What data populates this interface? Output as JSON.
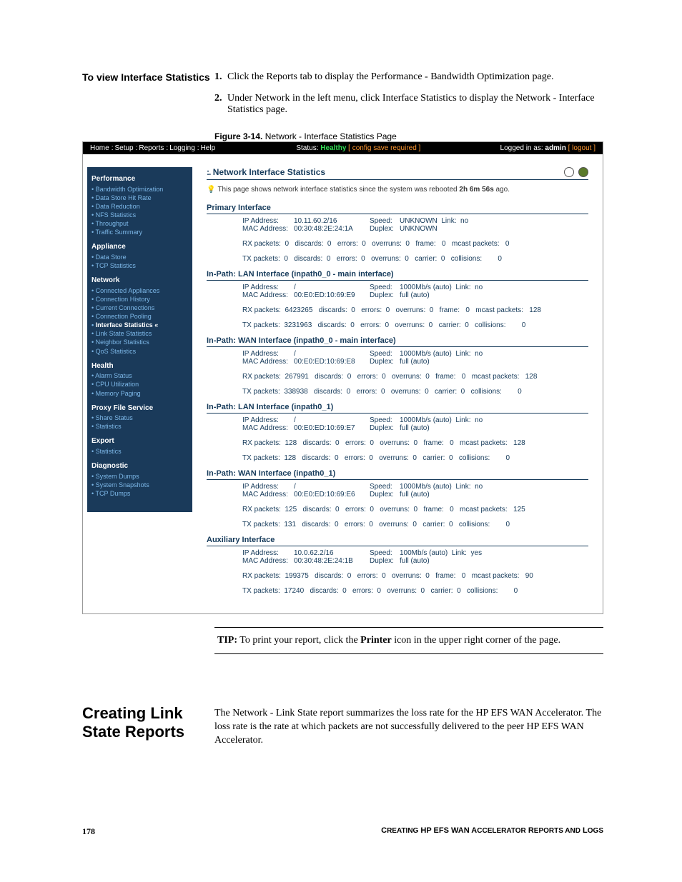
{
  "instructions": {
    "heading": "To view Interface Statistics",
    "steps": [
      "Click the Reports tab to display the Performance - Bandwidth Optimization page.",
      "Under Network in the left menu, click Interface Statistics to display the Network - Interface Statistics page."
    ]
  },
  "figure": {
    "label": "Figure 3-14.",
    "title": "Network - Interface Statistics Page"
  },
  "screenshot": {
    "topmenu": [
      "Home",
      "Setup",
      "Reports",
      "Logging",
      "Help"
    ],
    "status_prefix": "Status:",
    "status_value": "Healthy",
    "status_note": "[ config save required ]",
    "logged_prefix": "Logged in as:",
    "logged_user": "admin",
    "logout": "[ logout ]",
    "sidebar": [
      {
        "h": "Performance",
        "items": [
          "Bandwidth Optimization",
          "Data Store Hit Rate",
          "Data Reduction",
          "NFS Statistics",
          "Throughput",
          "Traffic Summary"
        ]
      },
      {
        "h": "Appliance",
        "items": [
          "Data Store",
          "TCP Statistics"
        ]
      },
      {
        "h": "Network",
        "items": [
          "Connected Appliances",
          "Connection History",
          "Current Connections",
          "Connection Pooling",
          "Interface Statistics",
          "Link State Statistics",
          "Neighbor Statistics",
          "QoS Statistics"
        ],
        "active": 4
      },
      {
        "h": "Health",
        "items": [
          "Alarm Status",
          "CPU Utilization",
          "Memory Paging"
        ]
      },
      {
        "h": "Proxy File Service",
        "items": [
          "Share Status",
          "Statistics"
        ]
      },
      {
        "h": "Export",
        "items": [
          "Statistics"
        ]
      },
      {
        "h": "Diagnostic",
        "items": [
          "System Dumps",
          "System Snapshots",
          "TCP Dumps"
        ]
      }
    ],
    "page_title": "Network Interface Statistics",
    "note": "This page shows network interface statistics since the system was rebooted 2h 6m 56s ago.",
    "note_bold": "2h 6m 56s",
    "interfaces": [
      {
        "name": "Primary Interface",
        "ip": "10.11.60.2/16",
        "mac": "00:30:48:2E:24:1A",
        "speed": "UNKNOWN",
        "duplex": "UNKNOWN",
        "link": "no",
        "rx": {
          "packets": "0",
          "discards": "0",
          "errors": "0",
          "overruns": "0",
          "frame": "0",
          "mcast": "0"
        },
        "tx": {
          "packets": "0",
          "discards": "0",
          "errors": "0",
          "overruns": "0",
          "carrier": "0",
          "collisions": "0"
        }
      },
      {
        "name": "In-Path: LAN Interface (inpath0_0 - main interface)",
        "ip": "/",
        "mac": "00:E0:ED:10:69:E9",
        "speed": "1000Mb/s (auto)",
        "duplex": "full (auto)",
        "link": "no",
        "rx": {
          "packets": "6423265",
          "discards": "0",
          "errors": "0",
          "overruns": "0",
          "frame": "0",
          "mcast": "128"
        },
        "tx": {
          "packets": "3231963",
          "discards": "0",
          "errors": "0",
          "overruns": "0",
          "carrier": "0",
          "collisions": "0"
        }
      },
      {
        "name": "In-Path: WAN Interface (inpath0_0 - main interface)",
        "ip": "/",
        "mac": "00:E0:ED:10:69:E8",
        "speed": "1000Mb/s (auto)",
        "duplex": "full (auto)",
        "link": "no",
        "rx": {
          "packets": "267991",
          "discards": "0",
          "errors": "0",
          "overruns": "0",
          "frame": "0",
          "mcast": "128"
        },
        "tx": {
          "packets": "338938",
          "discards": "0",
          "errors": "0",
          "overruns": "0",
          "carrier": "0",
          "collisions": "0"
        }
      },
      {
        "name": "In-Path: LAN Interface (inpath0_1)",
        "ip": "/",
        "mac": "00:E0:ED:10:69:E7",
        "speed": "1000Mb/s (auto)",
        "duplex": "full (auto)",
        "link": "no",
        "rx": {
          "packets": "128",
          "discards": "0",
          "errors": "0",
          "overruns": "0",
          "frame": "0",
          "mcast": "128"
        },
        "tx": {
          "packets": "128",
          "discards": "0",
          "errors": "0",
          "overruns": "0",
          "carrier": "0",
          "collisions": "0"
        }
      },
      {
        "name": "In-Path: WAN Interface (inpath0_1)",
        "ip": "/",
        "mac": "00:E0:ED:10:69:E6",
        "speed": "1000Mb/s (auto)",
        "duplex": "full (auto)",
        "link": "no",
        "rx": {
          "packets": "125",
          "discards": "0",
          "errors": "0",
          "overruns": "0",
          "frame": "0",
          "mcast": "125"
        },
        "tx": {
          "packets": "131",
          "discards": "0",
          "errors": "0",
          "overruns": "0",
          "carrier": "0",
          "collisions": "0"
        }
      },
      {
        "name": "Auxiliary Interface",
        "ip": "10.0.62.2/16",
        "mac": "00:30:48:2E:24:1B",
        "speed": "100Mb/s (auto)",
        "duplex": "full (auto)",
        "link": "yes",
        "rx": {
          "packets": "199375",
          "discards": "0",
          "errors": "0",
          "overruns": "0",
          "frame": "0",
          "mcast": "90"
        },
        "tx": {
          "packets": "17240",
          "discards": "0",
          "errors": "0",
          "overruns": "0",
          "carrier": "0",
          "collisions": "0"
        }
      }
    ]
  },
  "tip": {
    "label": "TIP:",
    "text": "To print your report, click the Printer icon in the upper right corner of the page.",
    "bold": "Printer"
  },
  "section2": {
    "heading": "Creating Link State Reports",
    "body": "The Network - Link State report summarizes the loss rate for the HP EFS WAN Accelerator. The loss rate is the rate at which packets are not successfully delivered to the peer HP EFS WAN Accelerator."
  },
  "footer": {
    "page": "178",
    "title_pre": "C",
    "title": "REATING HP EFS WAN ACCELERATOR REPORTS AND LOGS"
  }
}
